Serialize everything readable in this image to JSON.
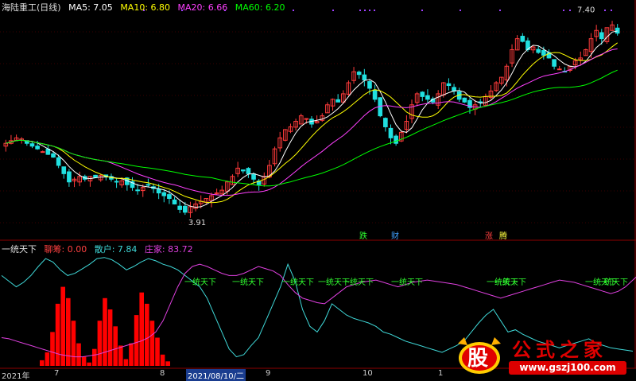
{
  "header": {
    "title": "海陆重工(日线)",
    "ma5": "MA5: 7.05",
    "ma10": "MA10: 6.80",
    "ma20": "MA20: 6.66",
    "ma60": "MA60: 6.20"
  },
  "indicator_header": {
    "title": "一统天下",
    "chouma": "聊筹: 0.00",
    "sanhu": "散户: 7.84",
    "zhuangjia": "庄家: 83.72"
  },
  "x_axis": {
    "labels": [
      "2021年",
      "7",
      "8",
      "2021/08/10/二",
      "9",
      "10",
      "1"
    ]
  },
  "watermark": {
    "glyph": "股",
    "title": "公式之家",
    "url": "www.gszj100.com"
  },
  "colors": {
    "up": "#ff3b3b",
    "down": "#20e0e0",
    "ma5": "#ffffff",
    "ma10": "#ffff00",
    "ma20": "#ff40ff",
    "ma60": "#00ff00",
    "cyan_line": "#3fd8d8",
    "magenta_line": "#e040e0",
    "hist": "#ff0000",
    "signal_text": "#30ff30"
  },
  "chart_data": [
    {
      "type": "candlestick",
      "title": "海陆重工(日线)",
      "price_range": [
        3.5,
        7.6
      ],
      "annotations": [
        {
          "text": "3.91",
          "label": "low"
        },
        {
          "text": "7.40",
          "label": "high"
        }
      ],
      "events": [
        {
          "text": "跌",
          "color": "#30ff30"
        },
        {
          "text": "财",
          "color": "#40a0ff"
        },
        {
          "text": "涨",
          "color": "#ff4040"
        },
        {
          "text": "腾",
          "color": "#ffff40"
        }
      ],
      "close": [
        5.2,
        5.25,
        5.3,
        5.28,
        5.2,
        5.15,
        5.1,
        5.05,
        5.0,
        4.95,
        4.8,
        4.65,
        4.5,
        4.55,
        4.6,
        4.55,
        4.6,
        4.58,
        4.62,
        4.6,
        4.55,
        4.5,
        4.52,
        4.45,
        4.4,
        4.35,
        4.4,
        4.45,
        4.38,
        4.3,
        4.25,
        4.2,
        4.1,
        4.0,
        3.95,
        4.05,
        4.1,
        4.15,
        4.2,
        4.25,
        4.3,
        4.35,
        4.5,
        4.6,
        4.75,
        4.7,
        4.65,
        4.55,
        4.45,
        4.6,
        4.8,
        5.1,
        5.3,
        5.45,
        5.5,
        5.6,
        5.7,
        5.65,
        5.55,
        5.6,
        5.7,
        5.9,
        6.0,
        5.95,
        6.1,
        6.3,
        6.5,
        6.45,
        6.35,
        6.2,
        6.0,
        5.7,
        5.5,
        5.3,
        5.2,
        5.4,
        5.6,
        5.9,
        6.1,
        6.05,
        6.0,
        5.95,
        6.1,
        6.3,
        6.25,
        6.15,
        6.0,
        5.95,
        5.85,
        5.9,
        5.95,
        6.05,
        6.15,
        6.3,
        6.4,
        6.6,
        6.9,
        7.1,
        7.05,
        6.9,
        6.95,
        6.85,
        6.8,
        6.75,
        6.6,
        6.55,
        6.5,
        6.6,
        6.7,
        6.75,
        6.9,
        7.1,
        7.25,
        7.1,
        7.3,
        7.35,
        7.2
      ]
    },
    {
      "type": "line",
      "title": "一统天下",
      "y_range": [
        0,
        100
      ],
      "series": [
        {
          "name": "散户",
          "color": "#3fd8d8",
          "values": [
            80,
            75,
            70,
            74,
            80,
            88,
            95,
            92,
            85,
            80,
            82,
            86,
            90,
            95,
            96,
            94,
            90,
            85,
            88,
            92,
            95,
            93,
            90,
            88,
            85,
            80,
            75,
            70,
            60,
            45,
            30,
            15,
            8,
            10,
            18,
            25,
            40,
            55,
            70,
            90,
            75,
            50,
            35,
            30,
            40,
            55,
            50,
            45,
            42,
            40,
            38,
            35,
            30,
            28,
            25,
            22,
            20,
            18,
            16,
            14,
            12,
            15,
            18,
            22,
            30,
            38,
            45,
            50,
            40,
            30,
            32,
            28,
            25,
            22,
            20,
            18,
            16,
            18,
            20,
            22,
            24,
            20,
            18,
            16,
            15,
            14,
            13
          ]
        },
        {
          "name": "庄家",
          "color": "#e040e0",
          "values": [
            25,
            24,
            22,
            20,
            18,
            16,
            14,
            12,
            10,
            9,
            8,
            8,
            9,
            10,
            12,
            14,
            16,
            18,
            20,
            22,
            25,
            30,
            40,
            55,
            70,
            82,
            88,
            90,
            88,
            85,
            82,
            80,
            80,
            82,
            85,
            88,
            86,
            84,
            80,
            72,
            65,
            60,
            58,
            56,
            55,
            60,
            65,
            70,
            72,
            74,
            75,
            76,
            74,
            72,
            70,
            72,
            74,
            75,
            76,
            75,
            74,
            73,
            72,
            70,
            68,
            66,
            64,
            62,
            60,
            62,
            64,
            66,
            68,
            70,
            72,
            74,
            76,
            75,
            74,
            72,
            70,
            68,
            66,
            64,
            66,
            70,
            76,
            82
          ]
        }
      ],
      "signals": [
        "一统天下",
        "一统天下",
        "一统天下",
        "一统天下",
        "一统天下",
        "一统天下",
        "一统天下",
        "一统天下",
        "一统天下",
        "一统天下"
      ],
      "histogram": [
        5,
        12,
        30,
        55,
        70,
        60,
        40,
        20,
        8,
        3,
        15,
        40,
        60,
        50,
        35,
        18,
        6,
        20,
        45,
        65,
        55,
        40,
        25,
        10,
        4
      ]
    }
  ]
}
